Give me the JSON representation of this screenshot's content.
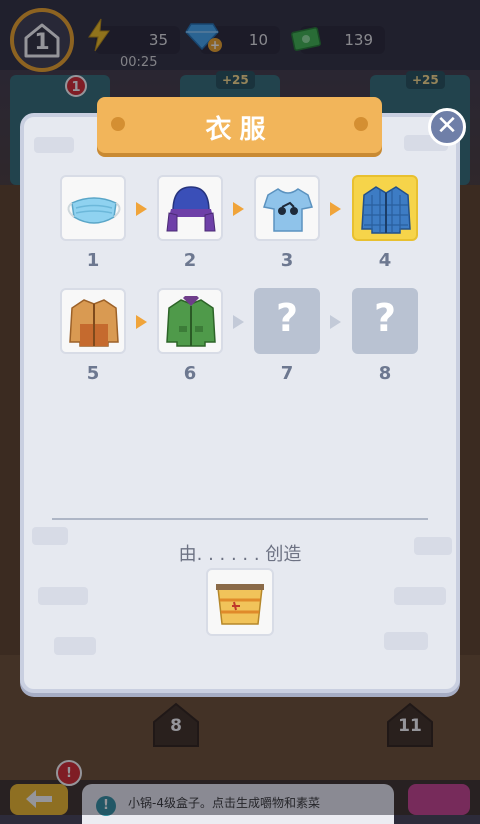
{
  "hud": {
    "level": "1",
    "timer": "00:25",
    "energy": "35",
    "gems": "10",
    "cash": "139"
  },
  "shelves": {
    "left_badge": "1",
    "left_tag": "+25",
    "right_tag": "+25"
  },
  "dialog": {
    "title": "衣服",
    "close_label": "✕",
    "chain": [
      {
        "number": "1",
        "icon": "face-mask-icon",
        "state": "known"
      },
      {
        "number": "2",
        "icon": "ushanka-hat-icon",
        "state": "known"
      },
      {
        "number": "3",
        "icon": "tshirt-icon",
        "state": "known"
      },
      {
        "number": "4",
        "icon": "blue-flannel-shirt-icon",
        "state": "selected"
      },
      {
        "number": "5",
        "icon": "tan-jacket-icon",
        "state": "known"
      },
      {
        "number": "6",
        "icon": "green-jacket-icon",
        "state": "known"
      },
      {
        "number": "7",
        "icon": "unknown-icon",
        "state": "locked",
        "glyph": "?"
      },
      {
        "number": "8",
        "icon": "unknown-icon",
        "state": "locked",
        "glyph": "?"
      }
    ],
    "made_by_label": "由. . . . . . 创造",
    "source_icon": "basket-icon"
  },
  "board": {
    "house_left": "8",
    "house_right": "11"
  },
  "bottom": {
    "tip_text": "小锅-4级盒子。点击生成嚼物和素菜",
    "tip_icon": "!",
    "alert_badge": "!"
  },
  "colors": {
    "banner": "#f2b55a",
    "selected": "#f6d44a",
    "arrow": "#f0a43a",
    "locked": "#b9c2d2"
  }
}
